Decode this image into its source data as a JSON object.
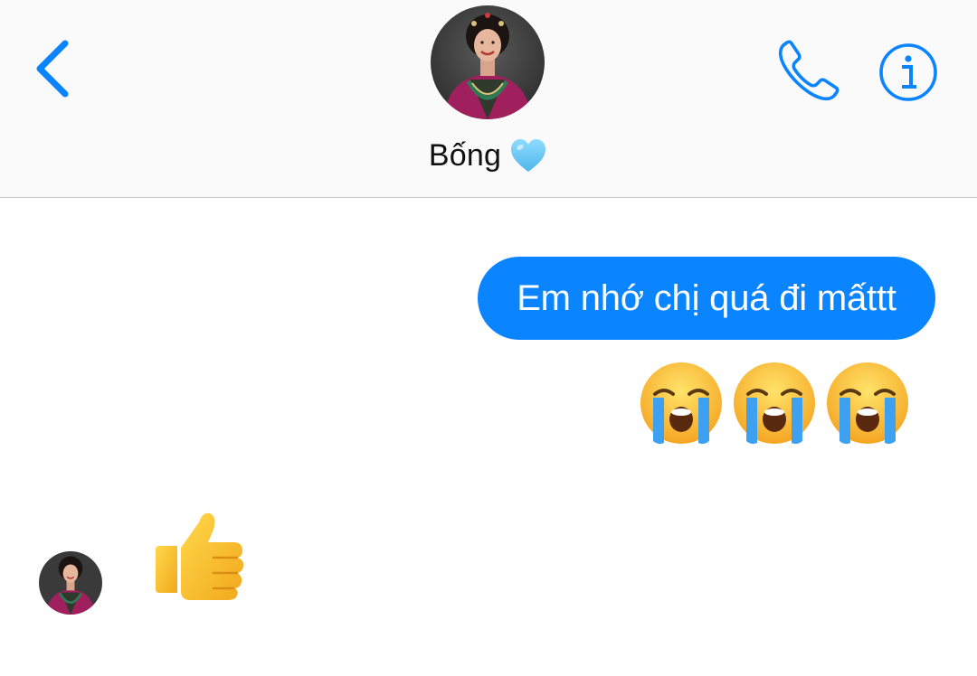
{
  "header": {
    "contact_name": "Bống",
    "contact_emoji": "light-blue-heart-icon",
    "back_icon": "chevron-left-icon",
    "call_icon": "phone-icon",
    "info_icon": "info-icon",
    "accent_color": "#0a84ff"
  },
  "conversation": {
    "outgoing": [
      {
        "type": "text",
        "text": "Em nhớ chị quá đi mấttt"
      },
      {
        "type": "emoji",
        "icons": [
          "loudly-crying-face-icon",
          "loudly-crying-face-icon",
          "loudly-crying-face-icon"
        ]
      }
    ],
    "incoming": [
      {
        "type": "emoji",
        "icons": [
          "thumbs-up-icon"
        ]
      }
    ]
  }
}
